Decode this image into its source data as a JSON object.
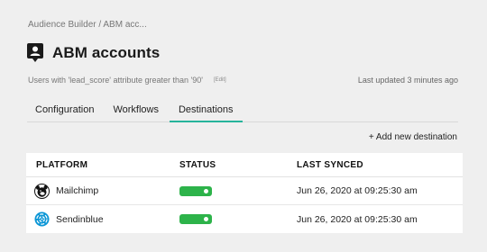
{
  "breadcrumb": "Audience Builder / ABM acc...",
  "page": {
    "title": "ABM accounts",
    "icon": "audience-badge-icon",
    "description": "Users with 'lead_score' attribute greater than '90'",
    "edit_label": "[Edit]",
    "last_updated": "Last updated 3 minutes ago"
  },
  "tabs": [
    {
      "label": "Configuration",
      "active": false
    },
    {
      "label": "Workflows",
      "active": false
    },
    {
      "label": "Destinations",
      "active": true
    }
  ],
  "actions": {
    "add_destination": "+ Add new destination"
  },
  "colors": {
    "accent": "#26b49b",
    "toggle_on": "#2db34a",
    "background": "#efefef"
  },
  "table": {
    "headers": [
      "PLATFORM",
      "STATUS",
      "LAST SYNCED"
    ],
    "rows": [
      {
        "platform": "Mailchimp",
        "icon": "mailchimp-logo-icon",
        "status_on": true,
        "last_synced": "Jun 26, 2020 at 09:25:30 am"
      },
      {
        "platform": "Sendinblue",
        "icon": "sendinblue-logo-icon",
        "status_on": true,
        "last_synced": "Jun 26, 2020 at 09:25:30 am"
      }
    ]
  }
}
